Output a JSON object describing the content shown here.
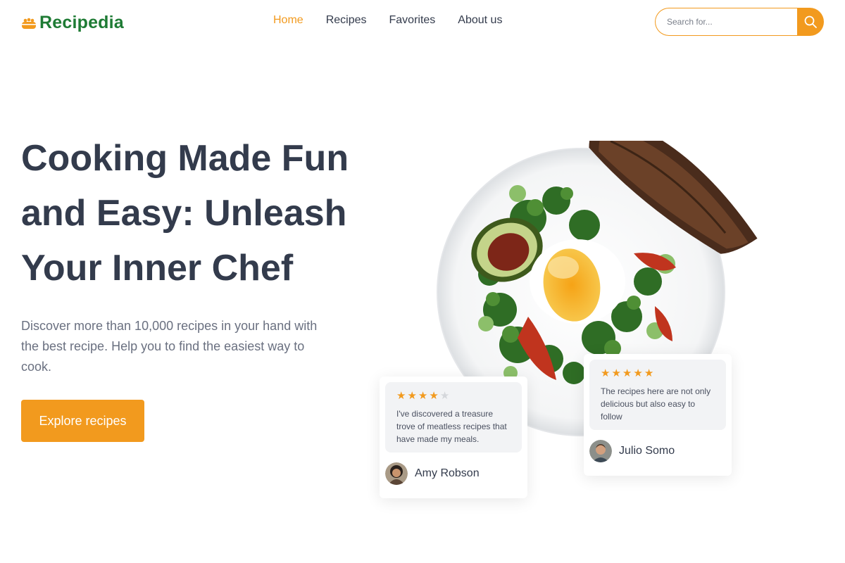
{
  "header": {
    "logo_text": "Recipedia",
    "logo_icon": "bread-basket-icon",
    "nav": [
      {
        "label": "Home",
        "active": true
      },
      {
        "label": "Recipes",
        "active": false
      },
      {
        "label": "Favorites",
        "active": false
      },
      {
        "label": "About us",
        "active": false
      }
    ],
    "search": {
      "placeholder": "Search for...",
      "value": "",
      "icon": "search-icon"
    }
  },
  "hero": {
    "title": "Cooking Made Fun and Easy: Unleash Your Inner Chef",
    "description": "Discover more than 10,000 recipes in your hand with the best recipe. Help you to find the easiest way to cook.",
    "cta_label": "Explore recipes"
  },
  "reviews": [
    {
      "rating": 4,
      "max_rating": 5,
      "text": "I've discovered a treasure trove of meatless recipes that have made my meals.",
      "name": "Amy Robson"
    },
    {
      "rating": 5,
      "max_rating": 5,
      "text": "The recipes here are not only delicious but also easy to follow",
      "name": "Julio Somo"
    }
  ],
  "colors": {
    "accent": "#f29a1e",
    "brand_green": "#1e7b34",
    "heading": "#333b4c",
    "body_text": "#6a7080"
  }
}
